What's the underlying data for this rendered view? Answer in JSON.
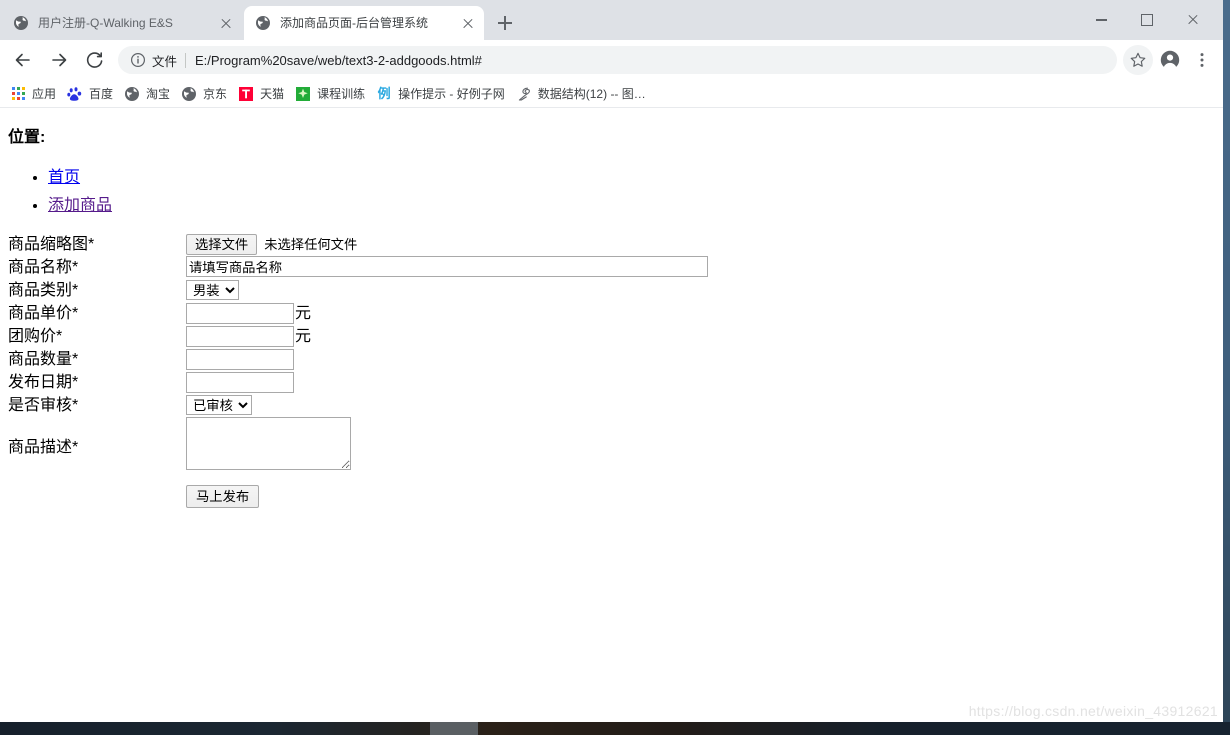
{
  "window": {
    "minimize_label": "−",
    "maximize_label": "□",
    "close_label": "×"
  },
  "tabs": [
    {
      "title": "用户注册-Q-Walking E&S",
      "favicon": "globe-icon",
      "active": false
    },
    {
      "title": "添加商品页面-后台管理系统",
      "favicon": "globe-icon",
      "active": true
    }
  ],
  "new_tab_label": "+",
  "toolbar": {
    "back_label": "←",
    "forward_label": "→",
    "reload_label": "⟳",
    "omnibox": {
      "info_icon": "info-circle-icon",
      "scheme_label": "文件",
      "url": "E:/Program%20save/web/text3-2-addgoods.html#"
    },
    "bookmark_star": "star-icon",
    "profile": "account-avatar-icon",
    "menu": "three-dot-menu-icon"
  },
  "bookmarks": [
    {
      "label": "应用",
      "icon": "apps-grid-icon",
      "color": "#4285f4"
    },
    {
      "label": "百度",
      "icon": "baidu-paw-icon",
      "color": "#2932e1"
    },
    {
      "label": "淘宝",
      "icon": "globe-icon",
      "color": "#5f6368"
    },
    {
      "label": "京东",
      "icon": "globe-icon",
      "color": "#5f6368"
    },
    {
      "label": "天猫",
      "icon": "tmall-t-icon",
      "color": "#ff0036"
    },
    {
      "label": "课程训练",
      "icon": "green-sparkle-icon",
      "color": "#22ac38"
    },
    {
      "label": "操作提示 - 好例子网",
      "icon": "example-li-icon",
      "color": "#29a8e0"
    },
    {
      "label": "数据结构(12) -- 图…",
      "icon": "pen-icon",
      "color": "#5f6368"
    }
  ],
  "page": {
    "position_title": "位置:",
    "breadcrumbs": [
      {
        "label": "首页",
        "state": "unvisited"
      },
      {
        "label": "添加商品",
        "state": "visited"
      }
    ],
    "form": {
      "rows": [
        {
          "label": "商品缩略图*",
          "type": "file"
        },
        {
          "label": "商品名称*",
          "type": "text-wide"
        },
        {
          "label": "商品类别*",
          "type": "select-category"
        },
        {
          "label": "商品单价*",
          "type": "text-unit"
        },
        {
          "label": "团购价*",
          "type": "text-unit"
        },
        {
          "label": "商品数量*",
          "type": "text-mid"
        },
        {
          "label": "发布日期*",
          "type": "text-mid"
        },
        {
          "label": "是否审核*",
          "type": "select-audit"
        },
        {
          "label": "商品描述*",
          "type": "textarea"
        }
      ],
      "file_button_label": "选择文件",
      "file_status_text": "未选择任何文件",
      "product_name_value": "请填写商品名称",
      "product_name_placeholder": "请填写商品名称",
      "category_selected": "男装",
      "category_options": [
        "男装"
      ],
      "price_value": "",
      "group_price_value": "",
      "quantity_value": "",
      "publish_date_value": "",
      "audit_selected": "已审核",
      "audit_options": [
        "已审核"
      ],
      "description_value": "",
      "unit_label": "元",
      "submit_label": "马上发布"
    }
  },
  "watermark": "https://blog.csdn.net/weixin_43912621"
}
